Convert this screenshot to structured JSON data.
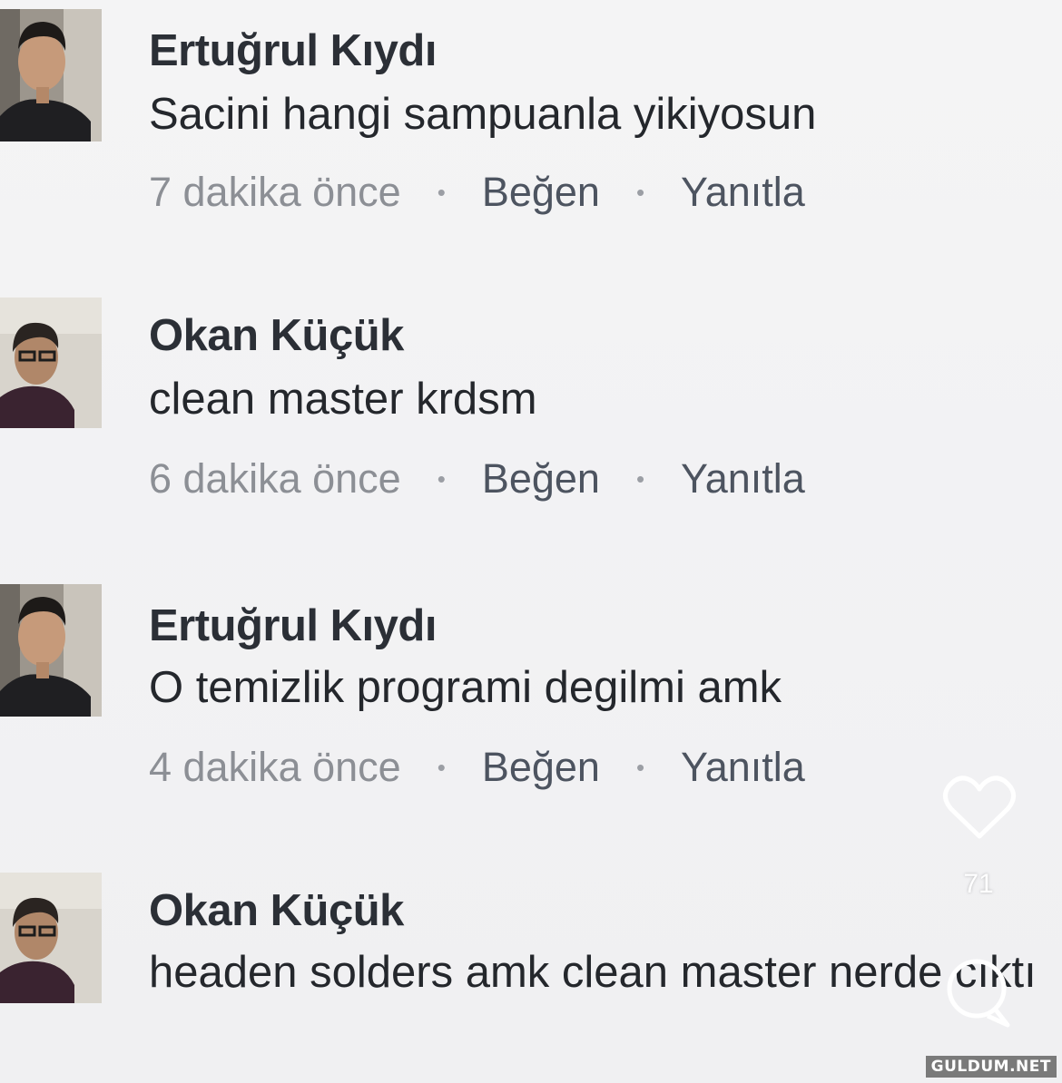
{
  "comments": [
    {
      "author": "Ertuğrul Kıydı",
      "text": "Sacini hangi sampuanla yikiyosun",
      "time": "7 dakika önce",
      "like_label": "Beğen",
      "reply_label": "Yanıtla",
      "separator": "•"
    },
    {
      "author": "Okan Küçük",
      "text": "clean master krdsm",
      "time": "6 dakika önce",
      "like_label": "Beğen",
      "reply_label": "Yanıtla",
      "separator": "•"
    },
    {
      "author": "Ertuğrul Kıydı",
      "text": "O temizlik programi degilmi amk",
      "time": "4 dakika önce",
      "like_label": "Beğen",
      "reply_label": "Yanıtla",
      "separator": "•"
    },
    {
      "author": "Okan Küçük",
      "text": "headen solders amk clean master nerde cıktı",
      "time": "",
      "like_label": "",
      "reply_label": "",
      "separator": ""
    }
  ],
  "overlay": {
    "like_count": "71",
    "heart_icon": "heart-outline-icon",
    "comment_icon": "speech-bubble-icon"
  },
  "watermark": "GULDUM.NET",
  "colors": {
    "name": "#2b2f36",
    "text": "#24272c",
    "time": "#8c8f95",
    "link": "#4d5460",
    "background": "#f2f2f3"
  }
}
